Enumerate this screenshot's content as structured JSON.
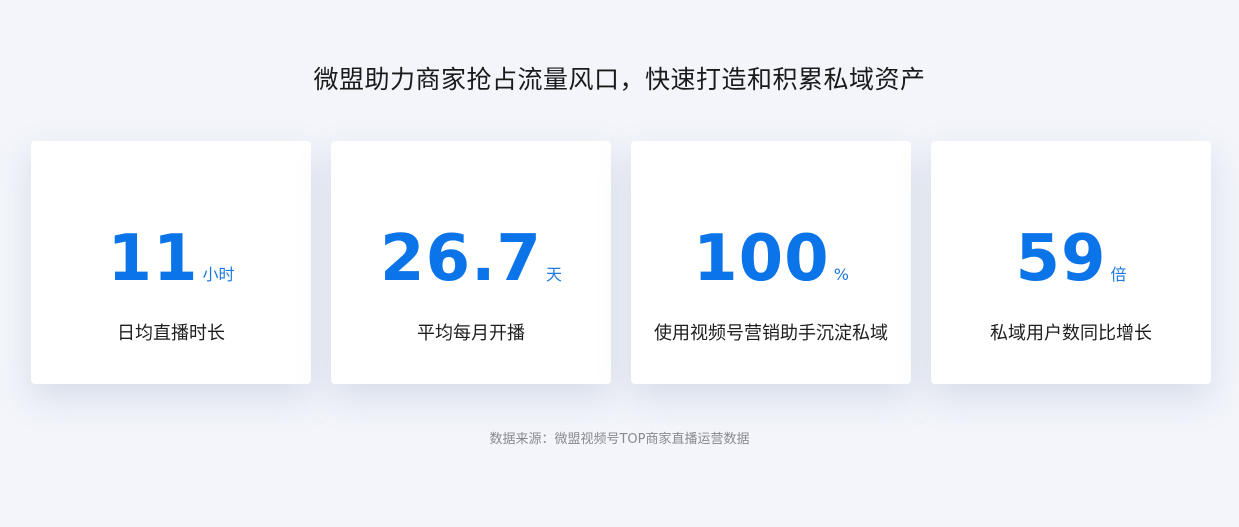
{
  "headline": "微盟助力商家抢占流量风口，快速打造和积累私域资产",
  "stats": [
    {
      "value": "11",
      "unit": "小时",
      "label": "日均直播时长"
    },
    {
      "value": "26.7",
      "unit": "天",
      "label": "平均每月开播"
    },
    {
      "value": "100",
      "unit": "%",
      "label": "使用视频号营销助手沉淀私域"
    },
    {
      "value": "59",
      "unit": "倍",
      "label": "私域用户数同比增长"
    }
  ],
  "source": "数据来源：微盟视频号TOP商家直播运营数据",
  "colors": {
    "background": "#f3f5fb",
    "accent": "#0b74e8",
    "card": "#ffffff",
    "text": "#1e1e1e",
    "muted": "#888a90"
  }
}
